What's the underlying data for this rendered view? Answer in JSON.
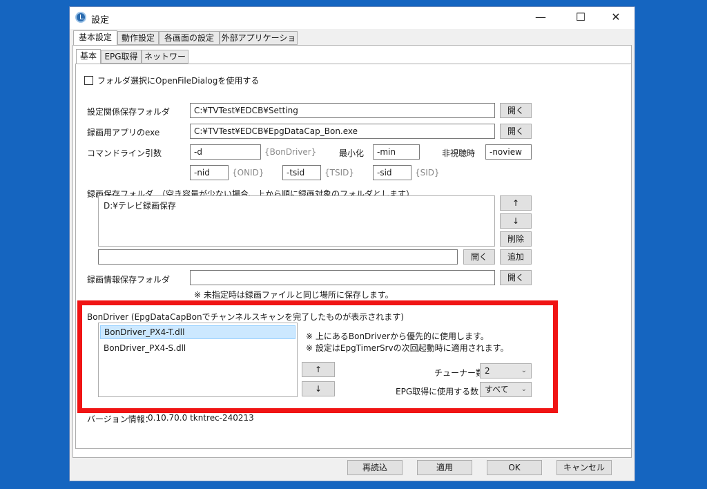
{
  "window": {
    "title": "設定",
    "controls": {
      "minimize": "—",
      "maximize": "☐",
      "close": "✕"
    }
  },
  "tabs_main": [
    "基本設定",
    "動作設定",
    "各画面の設定",
    "外部アプリケーション"
  ],
  "tabs_sub": [
    "基本",
    "EPG取得",
    "ネットワーク"
  ],
  "options": {
    "open_file_dialog_label": "フォルダ選択にOpenFileDialogを使用する",
    "open_file_dialog_checked": false
  },
  "paths": {
    "setting_folder_label": "設定関係保存フォルダ",
    "setting_folder_value": "C:¥TVTest¥EDCB¥Setting",
    "rec_app_label": "録画用アプリのexe",
    "rec_app_value": "C:¥TVTest¥EDCB¥EpgDataCap_Bon.exe",
    "open_button": "開く"
  },
  "cmdline": {
    "label": "コマンドライン引数",
    "d_value": "-d",
    "bondriver_hint": "{BonDriver}",
    "minimize_label": "最小化",
    "min_value": "-min",
    "noview_label": "非視聴時",
    "noview_value": "-noview",
    "nid_value": "-nid",
    "onid_hint": "{ONID}",
    "tsid_value": "-tsid",
    "tsid_hint": "{TSID}",
    "sid_value": "-sid",
    "sid_hint": "{SID}"
  },
  "rec_folders": {
    "label": "録画保存フォルダ　（空き容量が少ない場合、上から順に録画対象のフォルダとします）",
    "items": [
      "D:¥テレビ録画保存"
    ],
    "new_folder_value": "",
    "up_button": "↑",
    "down_button": "↓",
    "delete_button": "削除",
    "open_button": "開く",
    "add_button": "追加"
  },
  "rec_info_folder": {
    "label": "録画情報保存フォルダ",
    "value": "",
    "open_button": "開く",
    "note": "※ 未指定時は録画ファイルと同じ場所に保存します。"
  },
  "bondriver": {
    "label": "BonDriver (EpgDataCapBonでチャンネルスキャンを完了したものが表示されます)",
    "items": [
      "BonDriver_PX4-T.dll",
      "BonDriver_PX4-S.dll"
    ],
    "selected_index": 0,
    "note1": "※ 上にあるBonDriverから優先的に使用します。",
    "note2": "※ 設定はEpgTimerSrvの次回起動時に適用されます。",
    "up_button": "↑",
    "down_button": "↓",
    "tuner_count_label": "チューナー数",
    "tuner_count_value": "2",
    "epg_count_label": "EPG取得に使用する数",
    "epg_count_value": "すべて"
  },
  "version": {
    "label": "バージョン情報：",
    "value": "0.10.70.0 tkntrec-240213"
  },
  "footer": {
    "reload_button": "再読込",
    "apply_button": "適用",
    "ok_button": "OK",
    "cancel_button": "キャンセル"
  },
  "colors": {
    "desktop": "#1565c0",
    "highlight_border": "#f01414",
    "selection": "#cce8ff"
  }
}
